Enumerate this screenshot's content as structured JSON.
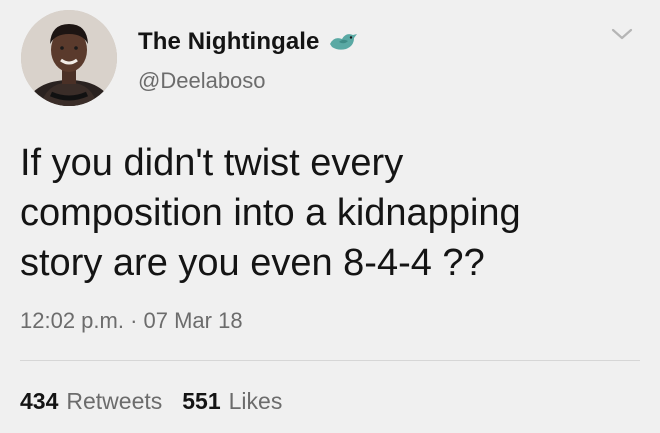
{
  "user": {
    "display_name": "The Nightingale",
    "handle": "@Deelaboso",
    "name_emoji_icon": "bird-icon",
    "avatar_icon": "profile-photo"
  },
  "tweet": {
    "text": "If you didn't twist every\ncomposition into a kidnapping\nstory are you even 8-4-4 ??",
    "timestamp": "12:02 p.m. · 07 Mar 18"
  },
  "stats": {
    "retweets_count": "434",
    "retweets_label": "Retweets",
    "likes_count": "551",
    "likes_label": "Likes"
  },
  "menu_icon": "chevron-down-icon",
  "colors": {
    "background": "#f0f0f0",
    "text": "#141414",
    "muted": "#6c6c6c",
    "bird": "#5aa9a4"
  }
}
